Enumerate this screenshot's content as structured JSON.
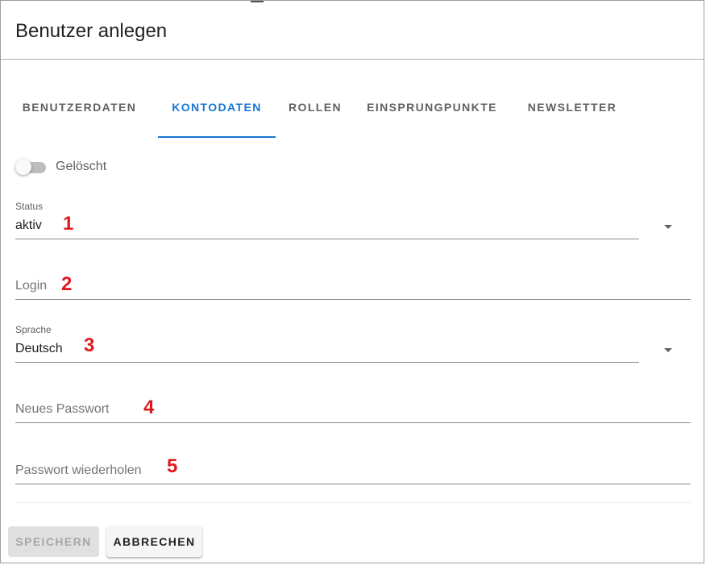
{
  "dialog": {
    "title": "Benutzer anlegen"
  },
  "tabs": [
    {
      "label": "BENUTZERDATEN",
      "active": false
    },
    {
      "label": "KONTODATEN",
      "active": true
    },
    {
      "label": "ROLLEN",
      "active": false
    },
    {
      "label": "EINSPRUNGPUNKTE",
      "active": false
    },
    {
      "label": "NEWSLETTER",
      "active": false
    }
  ],
  "deleted_switch": {
    "label": "Gelöscht",
    "checked": false
  },
  "fields": {
    "status": {
      "label": "Status",
      "value": "aktiv",
      "marker": "1"
    },
    "login": {
      "placeholder": "Login",
      "value": "",
      "marker": "2"
    },
    "language": {
      "label": "Sprache",
      "value": "Deutsch",
      "marker": "3"
    },
    "new_password": {
      "placeholder": "Neues Passwort",
      "value": "",
      "marker": "4"
    },
    "repeat_password": {
      "placeholder": "Passwort wiederholen",
      "value": "",
      "marker": "5"
    }
  },
  "actions": {
    "save_label": "SPEICHERN",
    "save_disabled": true,
    "cancel_label": "ABBRECHEN"
  },
  "colors": {
    "accent": "#1976d2",
    "marker": "#e0191f",
    "disabled_bg": "#e0e0e0"
  },
  "icons": {
    "dropdown": "caret-down-icon"
  }
}
